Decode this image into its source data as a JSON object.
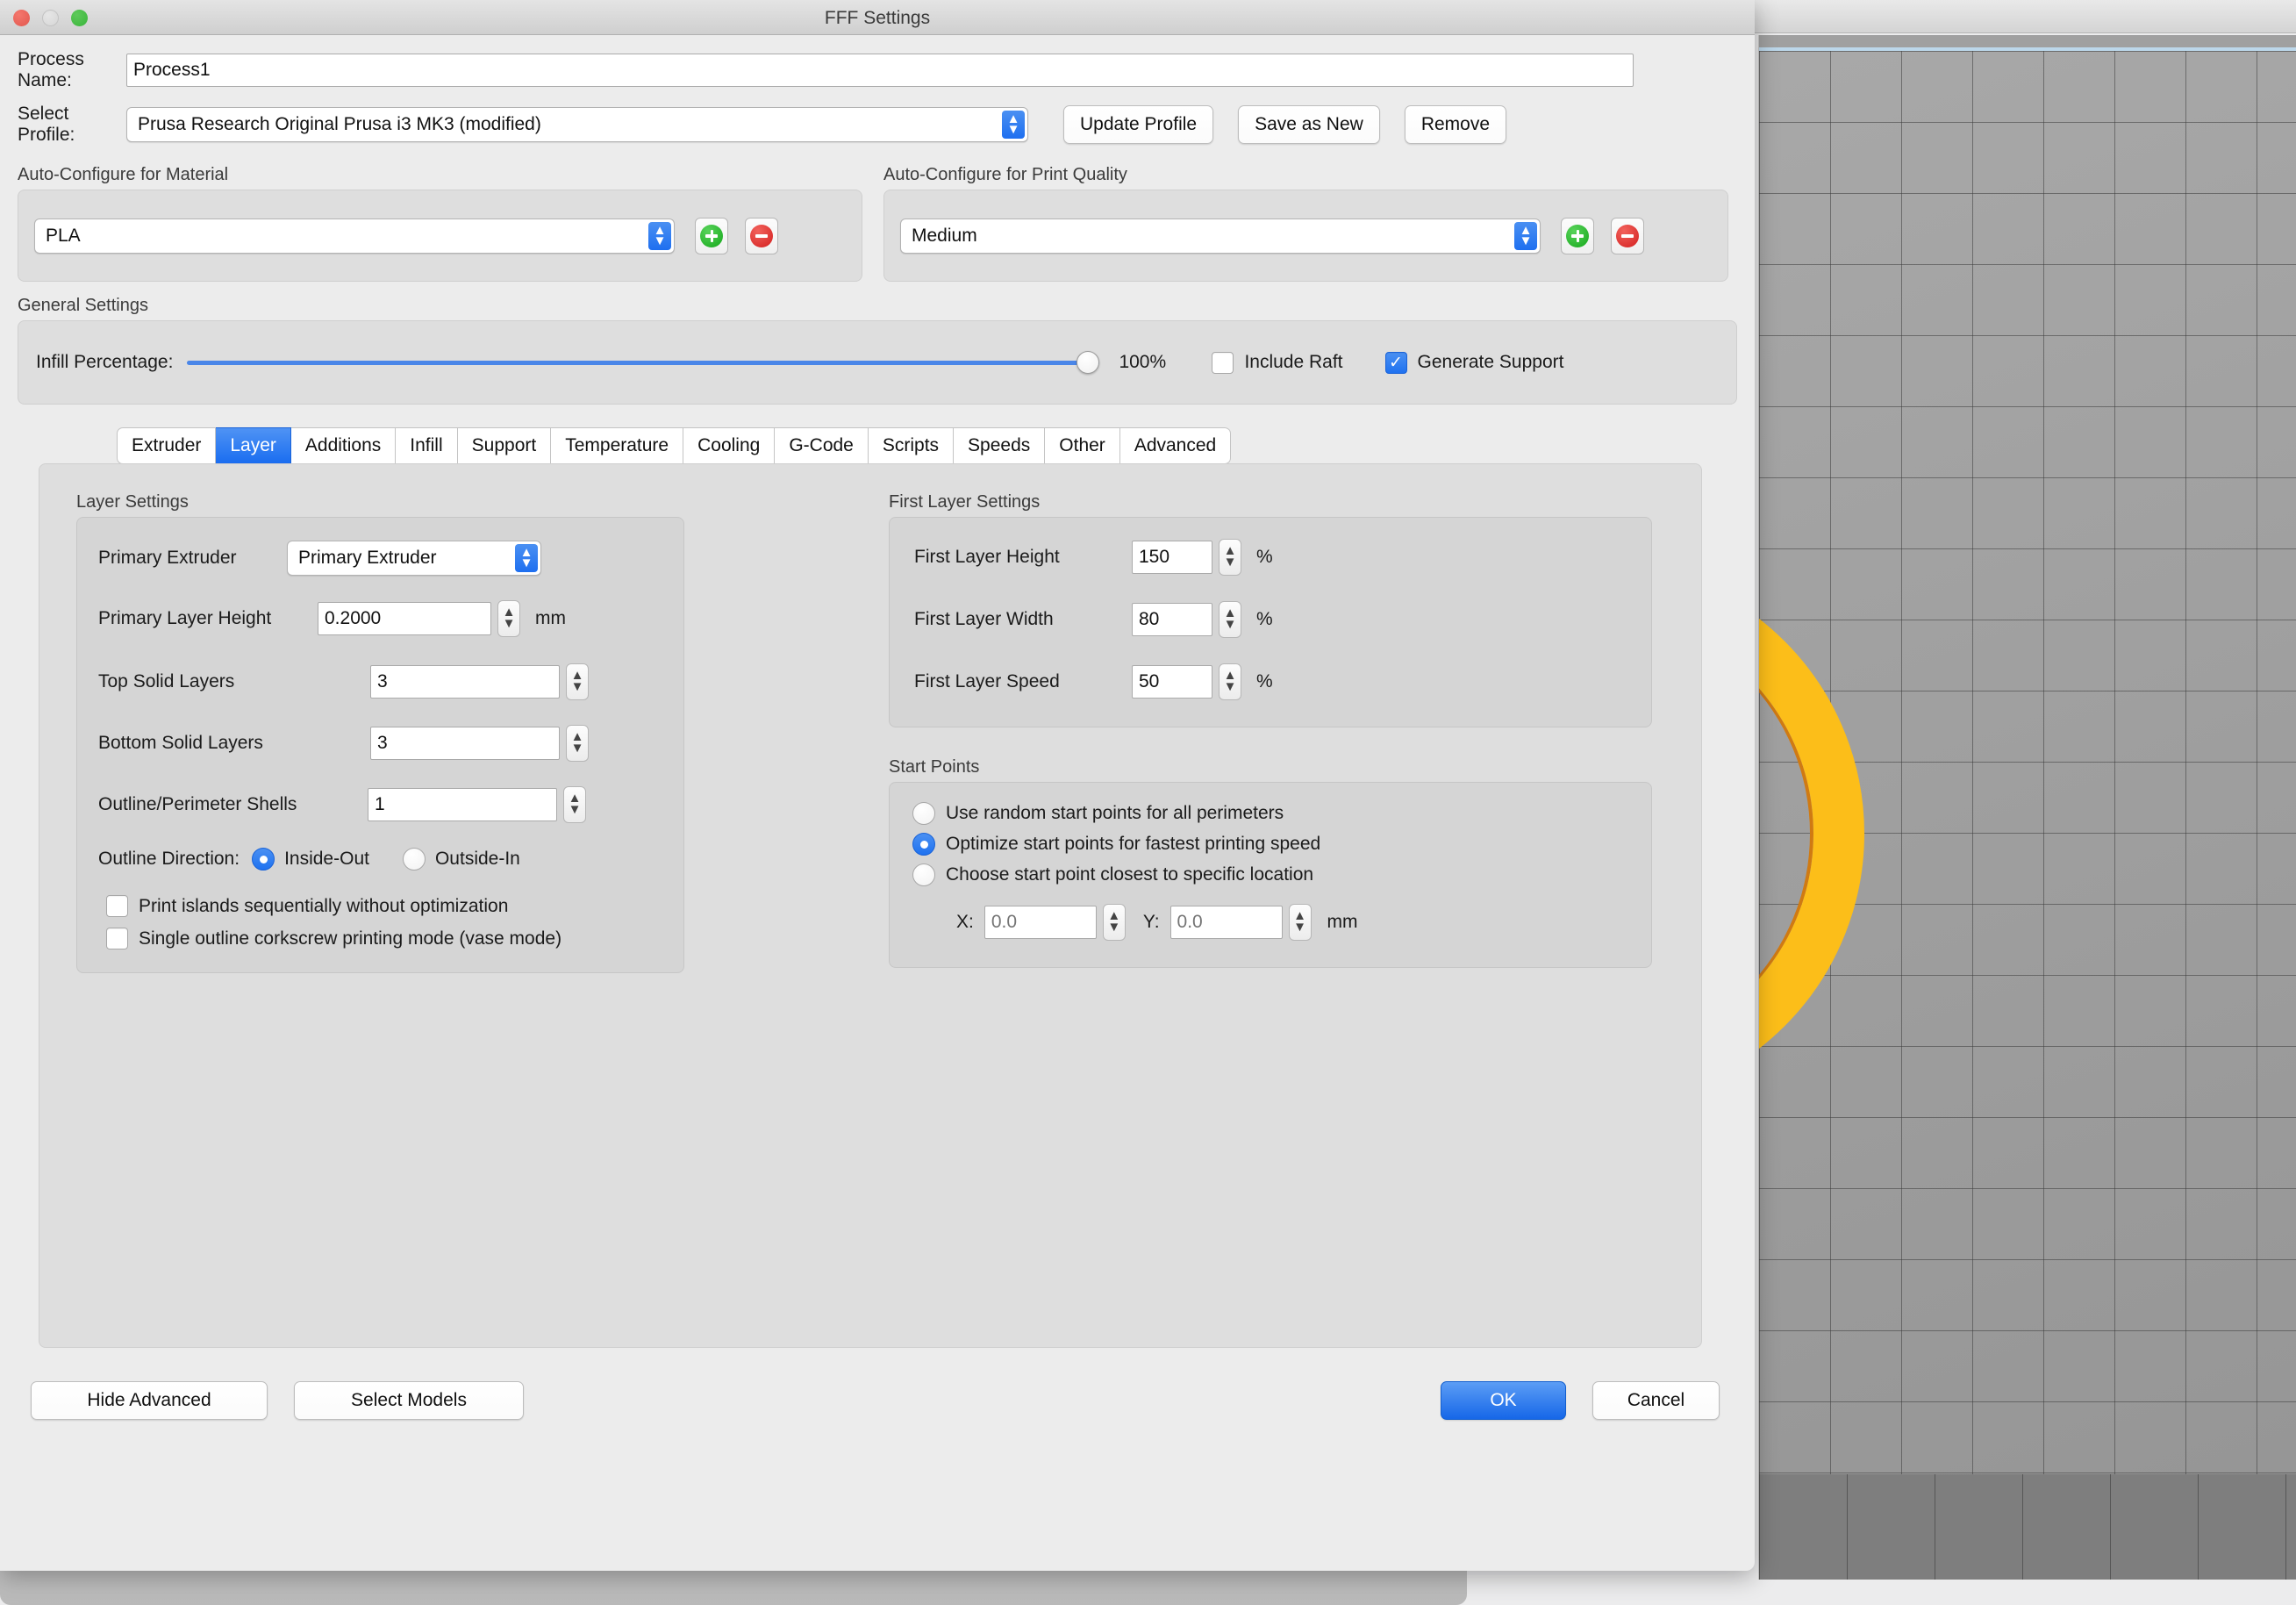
{
  "window": {
    "title": "FFF Settings",
    "traffic": {
      "close": "close-button",
      "minimize": "minimize-button",
      "maximize": "maximize-button"
    }
  },
  "process": {
    "name_label": "Process Name:",
    "name_value": "Process1",
    "profile_label": "Select Profile:",
    "profile_value": "Prusa Research Original Prusa i3 MK3 (modified)",
    "update_button": "Update Profile",
    "save_as_new_button": "Save as New",
    "remove_button": "Remove"
  },
  "material": {
    "group_label": "Auto-Configure for Material",
    "value": "PLA",
    "add": "+",
    "remove": "−"
  },
  "quality": {
    "group_label": "Auto-Configure for Print Quality",
    "value": "Medium",
    "add": "+",
    "remove": "−"
  },
  "general": {
    "group_label": "General Settings",
    "infill_label": "Infill Percentage:",
    "infill_value": "100%",
    "infill_percent": 100,
    "include_raft_label": "Include Raft",
    "include_raft_checked": false,
    "generate_support_label": "Generate Support",
    "generate_support_checked": true,
    "check_glyph": "✓"
  },
  "tabs": [
    {
      "label": "Extruder",
      "active": false
    },
    {
      "label": "Layer",
      "active": true
    },
    {
      "label": "Additions",
      "active": false
    },
    {
      "label": "Infill",
      "active": false
    },
    {
      "label": "Support",
      "active": false
    },
    {
      "label": "Temperature",
      "active": false
    },
    {
      "label": "Cooling",
      "active": false
    },
    {
      "label": "G-Code",
      "active": false
    },
    {
      "label": "Scripts",
      "active": false
    },
    {
      "label": "Speeds",
      "active": false
    },
    {
      "label": "Other",
      "active": false
    },
    {
      "label": "Advanced",
      "active": false
    }
  ],
  "layer_settings": {
    "group_label": "Layer Settings",
    "primary_extruder_label": "Primary Extruder",
    "primary_extruder_value": "Primary Extruder",
    "primary_layer_height_label": "Primary Layer Height",
    "primary_layer_height_value": "0.2000",
    "primary_layer_height_unit": "mm",
    "top_solid_layers_label": "Top Solid Layers",
    "top_solid_layers_value": "3",
    "bottom_solid_layers_label": "Bottom Solid Layers",
    "bottom_solid_layers_value": "3",
    "outline_shells_label": "Outline/Perimeter Shells",
    "outline_shells_value": "1",
    "outline_direction_label": "Outline Direction:",
    "inside_out_label": "Inside-Out",
    "inside_out_selected": true,
    "outside_in_label": "Outside-In",
    "outside_in_selected": false,
    "print_islands_label": "Print islands sequentially without optimization",
    "print_islands_checked": false,
    "vase_mode_label": "Single outline corkscrew printing mode (vase mode)",
    "vase_mode_checked": false
  },
  "first_layer": {
    "group_label": "First Layer Settings",
    "height_label": "First Layer Height",
    "height_value": "150",
    "height_unit": "%",
    "width_label": "First Layer Width",
    "width_value": "80",
    "width_unit": "%",
    "speed_label": "First Layer Speed",
    "speed_value": "50",
    "speed_unit": "%"
  },
  "start_points": {
    "group_label": "Start Points",
    "random_label": "Use random start points for all perimeters",
    "random_selected": false,
    "optimize_label": "Optimize start points for fastest printing speed",
    "optimize_selected": true,
    "closest_label": "Choose start point closest to specific location",
    "closest_selected": false,
    "x_label": "X:",
    "x_value": "0.0",
    "y_label": "Y:",
    "y_value": "0.0",
    "unit": "mm"
  },
  "footer": {
    "hide_advanced_button": "Hide Advanced",
    "select_models_button": "Select Models",
    "ok_button": "OK",
    "cancel_button": "Cancel"
  },
  "colors": {
    "accent": "#1f72f0",
    "slider": "#4a86e8",
    "model": "#fcbe19",
    "plate": "#a0a0a0",
    "dialog_bg": "#ececec",
    "group_bg": "#dedede"
  }
}
